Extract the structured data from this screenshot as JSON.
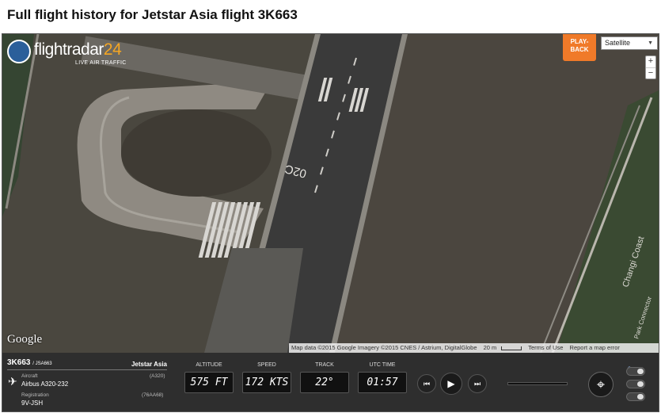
{
  "page": {
    "title": "Full flight history for Jetstar Asia flight 3K663"
  },
  "map": {
    "logo_prefix": "flightradar",
    "logo_number": "24",
    "tagline": "LIVE AIR TRAFFIC",
    "playback_line1": "PLAY-",
    "playback_line2": "BACK",
    "map_type": "Satellite",
    "zoom_in": "+",
    "zoom_out": "−",
    "google": "Google",
    "runway_marking": "02C",
    "road_label_1": "Changi Coast",
    "road_label_2": "Park Connector",
    "attribution": {
      "data": "Map data ©2015 Google Imagery ©2015 CNES / Astrium, DigitalGlobe",
      "scale": "20 m",
      "terms": "Terms of Use",
      "report": "Report a map error"
    }
  },
  "flight": {
    "callsign": "3K663",
    "alt_callsign": "/ JSA663",
    "airline": "Jetstar Asia",
    "aircraft_label": "Aircraft",
    "aircraft_value": "Airbus A320-232",
    "aircraft_code": "(A320)",
    "registration_label": "Registration",
    "registration_value": "9V-JSH",
    "registration_code": "(76AA68)"
  },
  "metrics": {
    "altitude_label": "ALTITUDE",
    "altitude_value": "575 FT",
    "speed_label": "SPEED",
    "speed_value": "172 KTS",
    "track_label": "TRACK",
    "track_value": "22°",
    "time_label": "UTC TIME",
    "time_value": "01:57"
  },
  "controls": {
    "rewind": "⏮",
    "play": "▶",
    "forward": "⏭",
    "locate": "⌖",
    "night_icon": "☾",
    "aircraft_icon": "✈"
  }
}
